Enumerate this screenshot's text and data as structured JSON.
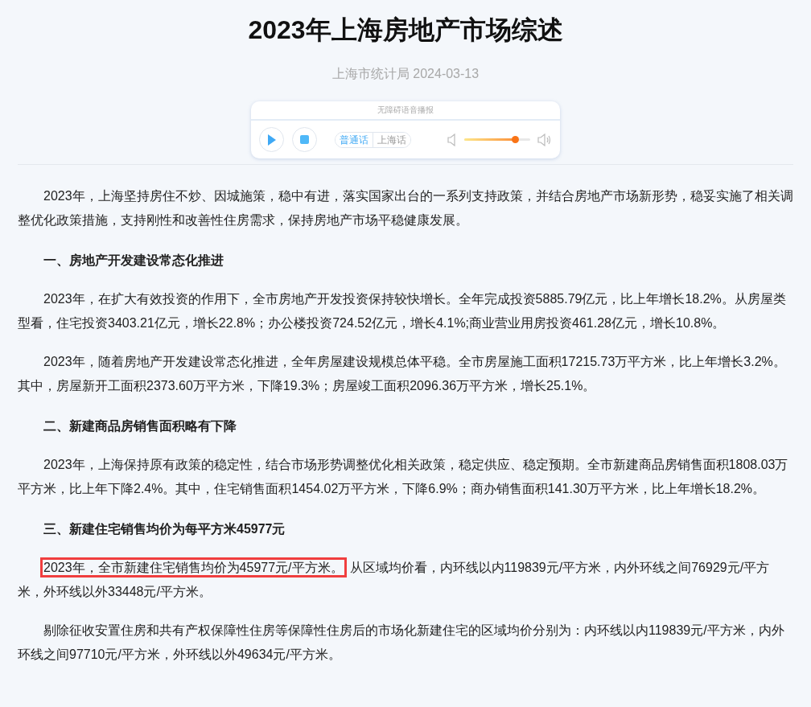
{
  "title": "2023年上海房地产市场综述",
  "meta": "上海市统计局 2024-03-13",
  "player": {
    "caption": "无障碍语音播报",
    "playing": false,
    "dialects": [
      {
        "label": "普通话",
        "selected": true
      },
      {
        "label": "上海话",
        "selected": false
      }
    ],
    "volume": {
      "level": 0.77
    }
  },
  "body": [
    {
      "kind": "paragraph",
      "text": "2023年，上海坚持房住不炒、因城施策，稳中有进，落实国家出台的一系列支持政策，并结合房地产市场新形势，稳妥实施了相关调整优化政策措施，支持刚性和改善性住房需求，保持房地产市场平稳健康发展。"
    },
    {
      "kind": "heading",
      "text": "一、房地产开发建设常态化推进"
    },
    {
      "kind": "paragraph",
      "text": "2023年，在扩大有效投资的作用下，全市房地产开发投资保持较快增长。全年完成投资5885.79亿元，比上年增长18.2%。从房屋类型看，住宅投资3403.21亿元，增长22.8%；办公楼投资724.52亿元，增长4.1%;商业营业用房投资461.28亿元，增长10.8%。"
    },
    {
      "kind": "paragraph",
      "text": "2023年，随着房地产开发建设常态化推进，全年房屋建设规模总体平稳。全市房屋施工面积17215.73万平方米，比上年增长3.2%。其中，房屋新开工面积2373.60万平方米，下降19.3%；房屋竣工面积2096.36万平方米，增长25.1%。"
    },
    {
      "kind": "heading",
      "text": "二、新建商品房销售面积略有下降"
    },
    {
      "kind": "paragraph",
      "text": "2023年，上海保持原有政策的稳定性，结合市场形势调整优化相关政策，稳定供应、稳定预期。全市新建商品房销售面积1808.03万平方米，比上年下降2.4%。其中，住宅销售面积1454.02万平方米，下降6.9%；商办销售面积141.30万平方米，比上年增长18.2%。"
    },
    {
      "kind": "heading",
      "text": "三、新建住宅销售均价为每平方米45977元"
    },
    {
      "kind": "paragraph",
      "highlight": "2023年，全市新建住宅销售均价为45977元/平方米。",
      "text": "从区域均价看，内环线以内119839元/平方米，内外环线之间76929元/平方米，外环线以外33448元/平方米。"
    },
    {
      "kind": "paragraph",
      "text": "剔除征收安置住房和共有产权保障性住房等保障性住房后的市场化新建住宅的区域均价分别为：内环线以内119839元/平方米，内外环线之间97710元/平方米，外环线以外49634元/平方米。"
    }
  ]
}
